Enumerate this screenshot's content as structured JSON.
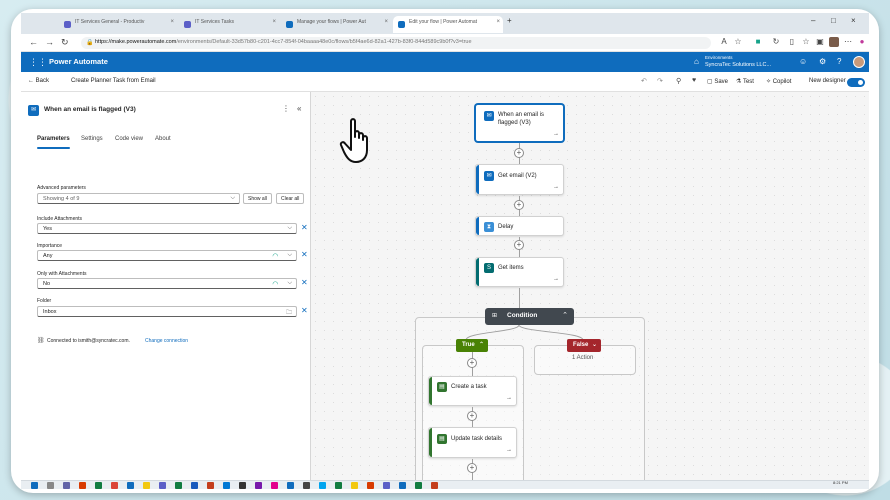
{
  "browser": {
    "tabs": [
      {
        "label": "IT Services General - Productiv"
      },
      {
        "label": "IT Services Tasks"
      },
      {
        "label": "Manage your flows | Power Aut"
      },
      {
        "label": "Edit your flow | Power Automat"
      }
    ],
    "url_host": "https://make.powerautomate.com",
    "url_path": "/environments/Default-33d57b80-c201-4cc7-854f-04baaaa48e0c/flows/b5f4ae6d-82a1-427b-83f0-844d589c9b0f?v3=true"
  },
  "app": {
    "name": "Power Automate",
    "environment_label": "Environments",
    "environment_name": "SyncraTec Solutions LLC..."
  },
  "command_bar": {
    "back": "Back",
    "flow_name": "Create Planner Task from Email",
    "save": "Save",
    "test": "Test",
    "copilot": "Copilot",
    "new_designer": "New designer"
  },
  "panel": {
    "title": "When an email is flagged (V3)",
    "tabs": [
      "Parameters",
      "Settings",
      "Code view",
      "About"
    ],
    "advanced_label": "Advanced parameters",
    "advanced_value": "Showing 4 of 9",
    "show_all": "Show all",
    "clear_all": "Clear all",
    "fields": [
      {
        "label": "Include Attachments",
        "value": "Yes"
      },
      {
        "label": "Importance",
        "value": "Any"
      },
      {
        "label": "Only with Attachments",
        "value": "No"
      },
      {
        "label": "Folder",
        "value": "Inbox"
      }
    ],
    "connected": "Connected to ismith@syncratec.com.",
    "change_connection": "Change connection"
  },
  "flow": {
    "trigger": "When an email is flagged (V3)",
    "get_email": "Get email (V2)",
    "delay": "Delay",
    "get_items": "Get items",
    "condition": "Condition",
    "true_label": "True",
    "false_label": "False",
    "false_sub": "1 Action",
    "create_task": "Create a task",
    "update_task": "Update task details"
  },
  "taskbar": {
    "time": "8:21 PM"
  },
  "colors": {
    "brand": "#0f6cbd",
    "true_branch": "#498205",
    "false_branch": "#a4262c",
    "condition": "#41484f",
    "planner": "#31752f"
  }
}
